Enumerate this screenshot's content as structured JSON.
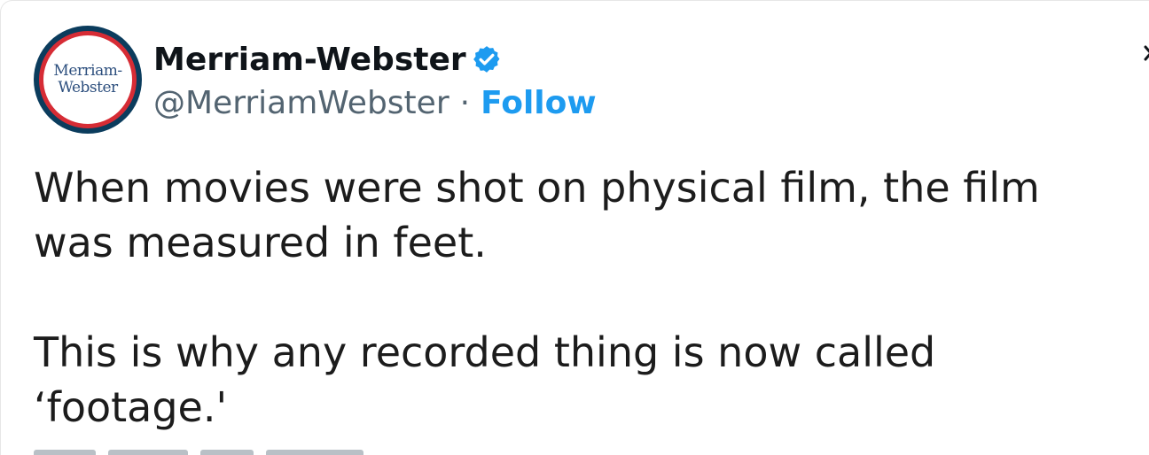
{
  "author": {
    "display_name": "Merriam-Webster",
    "handle": "@MerriamWebster",
    "separator": "·",
    "follow_label": "Follow",
    "verified": true,
    "avatar_text_line1": "Merriam-",
    "avatar_text_line2": "Webster"
  },
  "tweet": {
    "line1": "When movies were shot on physical film, the film",
    "line2": "was measured in feet.",
    "line3": "This is why any recorded thing is now called",
    "line4": "‘footage.'"
  },
  "colors": {
    "accent": "#1d9bf0",
    "name_text": "#0f1419",
    "handle_text": "#536471",
    "logo_ring": "#d62c35",
    "logo_text": "#2d4f7e"
  },
  "icons": {
    "verified": "verified-badge-icon",
    "close": "close-icon"
  }
}
